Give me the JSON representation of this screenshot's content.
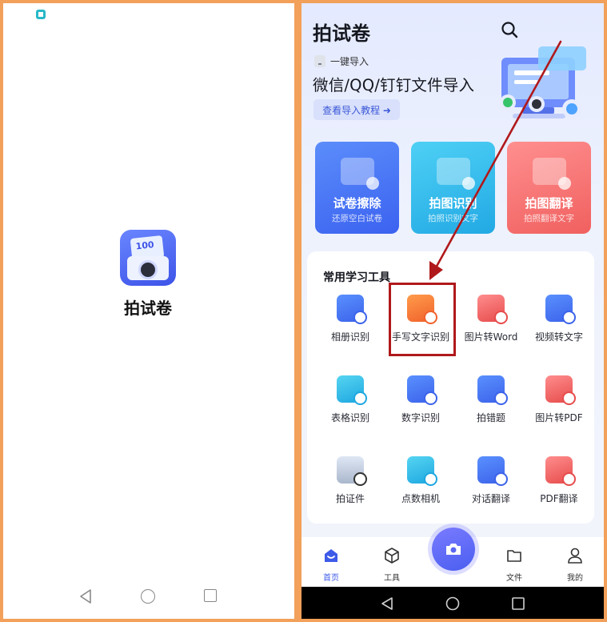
{
  "splash": {
    "icon_text": "100",
    "app_name": "拍试卷"
  },
  "app": {
    "title": "拍试卷",
    "import_tag": "一键导入",
    "import_title": "微信/QQ/钉钉文件导入",
    "import_link": "查看导入教程 ➜"
  },
  "feature_cards": [
    {
      "title": "试卷擦除",
      "subtitle": "还原空白试卷"
    },
    {
      "title": "拍图识别",
      "subtitle": "拍照识别文字"
    },
    {
      "title": "拍图翻译",
      "subtitle": "拍照翻译文字"
    }
  ],
  "tools": {
    "section_title": "常用学习工具",
    "items": [
      {
        "label": "相册识别",
        "icon": "album-scan-icon"
      },
      {
        "label": "手写文字识别",
        "icon": "handwriting-icon"
      },
      {
        "label": "图片转Word",
        "icon": "image-to-word-icon"
      },
      {
        "label": "视频转文字",
        "icon": "video-to-text-icon"
      },
      {
        "label": "表格识别",
        "icon": "table-scan-icon"
      },
      {
        "label": "数字识别",
        "icon": "number-scan-icon"
      },
      {
        "label": "拍错题",
        "icon": "mistake-capture-icon"
      },
      {
        "label": "图片转PDF",
        "icon": "image-to-pdf-icon"
      },
      {
        "label": "拍证件",
        "icon": "id-photo-icon"
      },
      {
        "label": "点数相机",
        "icon": "count-camera-icon"
      },
      {
        "label": "对话翻译",
        "icon": "dialogue-translate-icon"
      },
      {
        "label": "PDF翻译",
        "icon": "pdf-translate-icon"
      }
    ]
  },
  "bottom_nav": {
    "home": "首页",
    "tools": "工具",
    "files": "文件",
    "mine": "我的"
  },
  "colors": {
    "frame": "#f2a05a",
    "accent": "#3d5ae8",
    "annotation": "#b0191b"
  }
}
